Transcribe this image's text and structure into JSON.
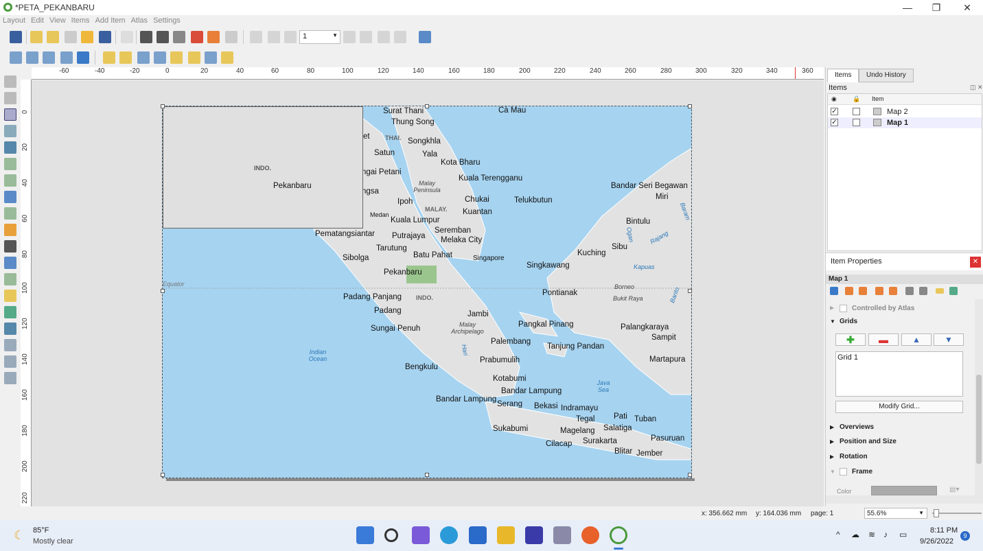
{
  "window": {
    "title": "*PETA_PEKANBARU",
    "minimize": "—",
    "maximize": "❐",
    "close": "✕"
  },
  "menu": [
    "Layout",
    "Edit",
    "View",
    "Items",
    "Add Item",
    "Atlas",
    "Settings"
  ],
  "toolbar": {
    "page_value": "1"
  },
  "ruler": {
    "h_ticks": [
      "-60",
      "-40",
      "-20",
      "0",
      "20",
      "40",
      "60",
      "80",
      "100",
      "120",
      "140",
      "160",
      "180",
      "200",
      "220",
      "240",
      "260",
      "280",
      "300",
      "320",
      "340",
      "360"
    ],
    "v_ticks": [
      "0",
      "20",
      "40",
      "60",
      "80",
      "100",
      "120",
      "140",
      "160",
      "180",
      "200",
      "220"
    ]
  },
  "map": {
    "inset": {
      "label_indo": "INDO.",
      "label_city": "Pekanbaru"
    },
    "cities": [
      "Surat Thani",
      "Cà Mau",
      "Thung Song",
      "Songkhla",
      "Satun",
      "Yala",
      "Kota Bharu",
      "ngai Petani",
      "Kuala Terengganu",
      "ngsa",
      "Ipoh",
      "Chukai",
      "Telukbutun",
      "Kuala Lumpur",
      "Kuantan",
      "Seremban",
      "Melaka City",
      "Pematangsiantar",
      "Putrajaya",
      "Tarutung",
      "Batu Pahat",
      "Sibolga",
      "Pekanbaru",
      "Singapore",
      "Singkawang",
      "Kuching",
      "Sibu",
      "Bintulu",
      "Bandar Seri Begawan",
      "Miri",
      "Padang Panjang",
      "Pontianak",
      "Padang",
      "Jambi",
      "Pangkal Pinang",
      "Sungai Penuh",
      "Palangkaraya",
      "Sampit",
      "Palembang",
      "Tanjung Pandan",
      "Prabumulih",
      "Martapura",
      "Bengkulu",
      "Kotabumi",
      "Bandar Lampung",
      "Bandar Lampung",
      "Serang",
      "Bekasi",
      "Indramayu",
      "Tegal",
      "Pati",
      "Tuban",
      "Sukabumi",
      "Magelang",
      "Salatiga",
      "Surakarta",
      "Pasuruan",
      "Cilacap",
      "Blitar",
      "Jember",
      "Medan",
      "et"
    ],
    "countries": [
      "THAI.",
      "MALAY.",
      "INDO."
    ],
    "regions": [
      "Malay Peninsula",
      "Malay Archipelago",
      "Borneo",
      "Bukit Raya"
    ],
    "water": [
      "Indian Ocean",
      "Java Sea",
      "Kapuas",
      "Rajang",
      "Baram",
      "Barito",
      "Hari",
      "Ogan"
    ],
    "equator": "Equator"
  },
  "items_panel": {
    "tabs": [
      "Items",
      "Undo History"
    ],
    "header": "Items",
    "col_item": "Item",
    "rows": [
      {
        "name": "Map 2",
        "visible": true,
        "locked": false
      },
      {
        "name": "Map 1",
        "visible": true,
        "locked": false
      }
    ]
  },
  "props_panel": {
    "title": "Item Properties",
    "item": "Map 1",
    "controlled_by_atlas": "Controlled by Atlas",
    "grids": "Grids",
    "grid_list": [
      "Grid 1"
    ],
    "modify_grid": "Modify Grid...",
    "sections": [
      "Overviews",
      "Position and Size",
      "Rotation",
      "Frame"
    ],
    "color_label": "Color"
  },
  "status": {
    "x": "x: 356.662 mm",
    "y": "y: 164.036 mm",
    "page": "page: 1",
    "zoom": "55.6%"
  },
  "taskbar": {
    "temp": "85°F",
    "weather": "Mostly clear",
    "time": "8:11 PM",
    "date": "9/26/2022",
    "badge": "9"
  }
}
